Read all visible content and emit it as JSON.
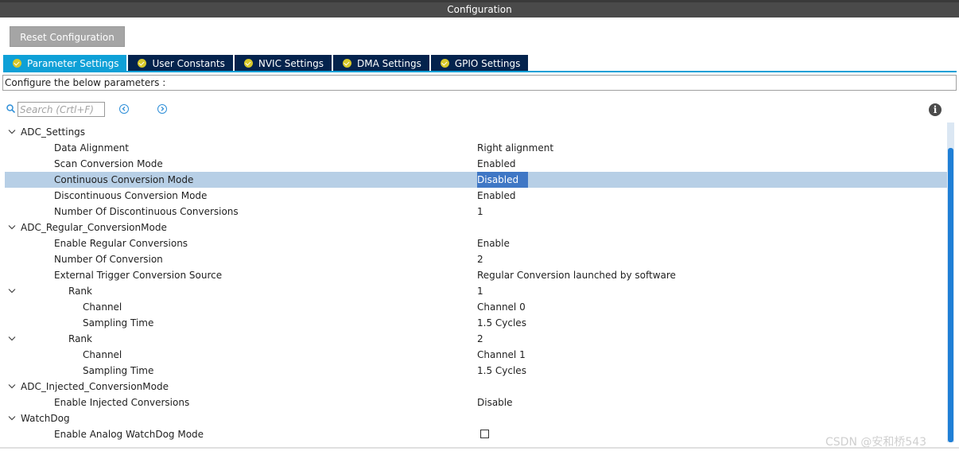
{
  "header": {
    "title": "Configuration"
  },
  "toolbar": {
    "reset_label": "Reset Configuration"
  },
  "tabs": [
    {
      "label": "Parameter Settings",
      "active": true
    },
    {
      "label": "User Constants",
      "active": false
    },
    {
      "label": "NVIC Settings",
      "active": false
    },
    {
      "label": "DMA Settings",
      "active": false
    },
    {
      "label": "GPIO Settings",
      "active": false
    }
  ],
  "description": "Configure the below parameters :",
  "search": {
    "placeholder": "Search (Crtl+F)"
  },
  "icons": {
    "search": "search-icon",
    "prev": "chevron-left-circle-icon",
    "next": "chevron-right-circle-icon",
    "info": "info-icon",
    "expand": "chevron-down-icon",
    "tab_status": "check-circle-icon"
  },
  "colors": {
    "active_tab": "#0ea0d7",
    "inactive_tab": "#04234d",
    "selected_row": "#b7cfe6",
    "selected_value": "#3f77c5",
    "scroll_thumb": "#1f7fd6"
  },
  "tree": {
    "groups": [
      {
        "label": "ADC_Settings",
        "items": [
          {
            "label": "Data Alignment",
            "value": "Right alignment"
          },
          {
            "label": "Scan Conversion Mode",
            "value": "Enabled"
          },
          {
            "label": "Continuous Conversion Mode",
            "value": "Disabled",
            "selected": true
          },
          {
            "label": "Discontinuous Conversion Mode",
            "value": "Enabled"
          },
          {
            "label": "Number Of Discontinuous Conversions",
            "value": "1"
          }
        ]
      },
      {
        "label": "ADC_Regular_ConversionMode",
        "items": [
          {
            "label": "Enable Regular Conversions",
            "value": "Enable"
          },
          {
            "label": "Number Of Conversion",
            "value": "2"
          },
          {
            "label": "External Trigger Conversion Source",
            "value": "Regular Conversion launched by software"
          }
        ],
        "ranks": [
          {
            "label": "Rank",
            "value": "1",
            "items": [
              {
                "label": "Channel",
                "value": "Channel 0"
              },
              {
                "label": "Sampling Time",
                "value": "1.5 Cycles"
              }
            ]
          },
          {
            "label": "Rank",
            "value": "2",
            "items": [
              {
                "label": "Channel",
                "value": "Channel 1"
              },
              {
                "label": "Sampling Time",
                "value": "1.5 Cycles"
              }
            ]
          }
        ]
      },
      {
        "label": "ADC_Injected_ConversionMode",
        "items": [
          {
            "label": "Enable Injected Conversions",
            "value": "Disable"
          }
        ]
      },
      {
        "label": "WatchDog",
        "items": [
          {
            "label": "Enable Analog WatchDog Mode",
            "checked": false
          }
        ]
      }
    ]
  },
  "watermark": "CSDN @安和桥543"
}
